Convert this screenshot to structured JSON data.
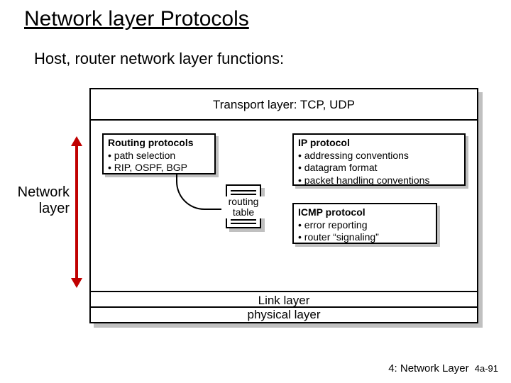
{
  "title": "Network layer Protocols",
  "subtitle": "Host, router network layer functions:",
  "side_label_l1": "Network",
  "side_label_l2": "layer",
  "layers": {
    "transport": "Transport layer: TCP, UDP",
    "link": "Link layer",
    "physical": "physical layer"
  },
  "routing": {
    "header": "Routing protocols",
    "b1": "• path selection",
    "b2": "• RIP, OSPF, BGP"
  },
  "ip": {
    "header": "IP protocol",
    "b1": "• addressing conventions",
    "b2": "• datagram format",
    "b3": "• packet handling conventions"
  },
  "icmp": {
    "header": "ICMP protocol",
    "b1": "• error reporting",
    "b2": "• router “signaling”"
  },
  "rtable_l1": "routing",
  "rtable_l2": "table",
  "footer_chapter": "4: Network Layer",
  "footer_page": "4a-91"
}
